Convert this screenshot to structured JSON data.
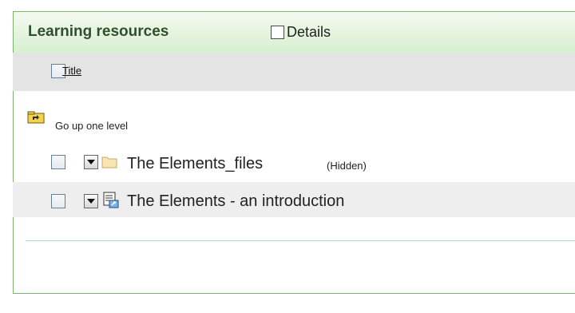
{
  "panel": {
    "title": "Learning resources",
    "details_label": "Details"
  },
  "table": {
    "column_title": "Title"
  },
  "up_level": {
    "label": "Go up one level"
  },
  "rows": [
    {
      "title": "The Elements_files",
      "tag": "(Hidden)",
      "icon": "folder-icon"
    },
    {
      "title": "The Elements - an introduction",
      "tag": "",
      "icon": "document-link-icon"
    }
  ],
  "colors": {
    "header_green": "#e4f4de",
    "border_green": "#7fb06e",
    "table_head_gray": "#e4e4e4",
    "alt_row_gray": "#eeeeee",
    "folder_yellow": "#f6e3a8"
  }
}
